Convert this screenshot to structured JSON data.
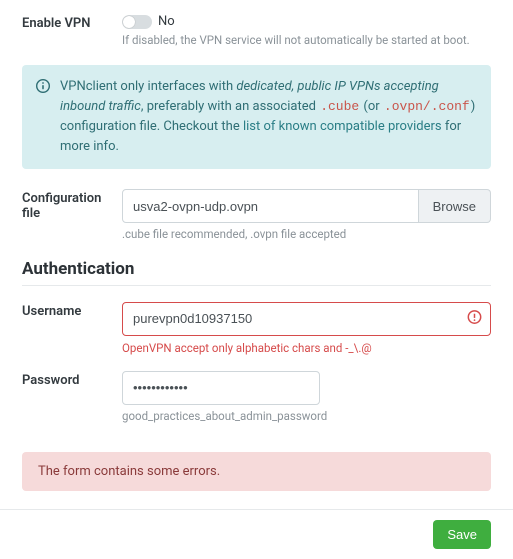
{
  "enable_vpn": {
    "label": "Enable VPN",
    "value_text": "No",
    "help": "If disabled, the VPN service will not automatically be started at boot."
  },
  "info_alert": {
    "pre": "VPNclient only interfaces with ",
    "em": "dedicated, public IP VPNs accepting inbound traffic",
    "mid1": ", preferably with an associated ",
    "code1": ".cube",
    "mid2": " (or ",
    "code2": ".ovpn/.conf",
    "mid3": ") configuration file. Checkout the ",
    "link": "list of known compatible providers",
    "tail": " for more info."
  },
  "config_file": {
    "label": "Configuration file",
    "value": "usva2-ovpn-udp.ovpn",
    "browse": "Browse",
    "help": ".cube file recommended, .ovpn file accepted"
  },
  "auth": {
    "heading": "Authentication",
    "username": {
      "label": "Username",
      "value": "purevpn0d10937150",
      "error": "OpenVPN accept only alphabetic chars and -_\\.@"
    },
    "password": {
      "label": "Password",
      "value": "••••••••••••",
      "help": "good_practices_about_admin_password"
    }
  },
  "form_error": "The form contains some errors.",
  "save": "Save"
}
